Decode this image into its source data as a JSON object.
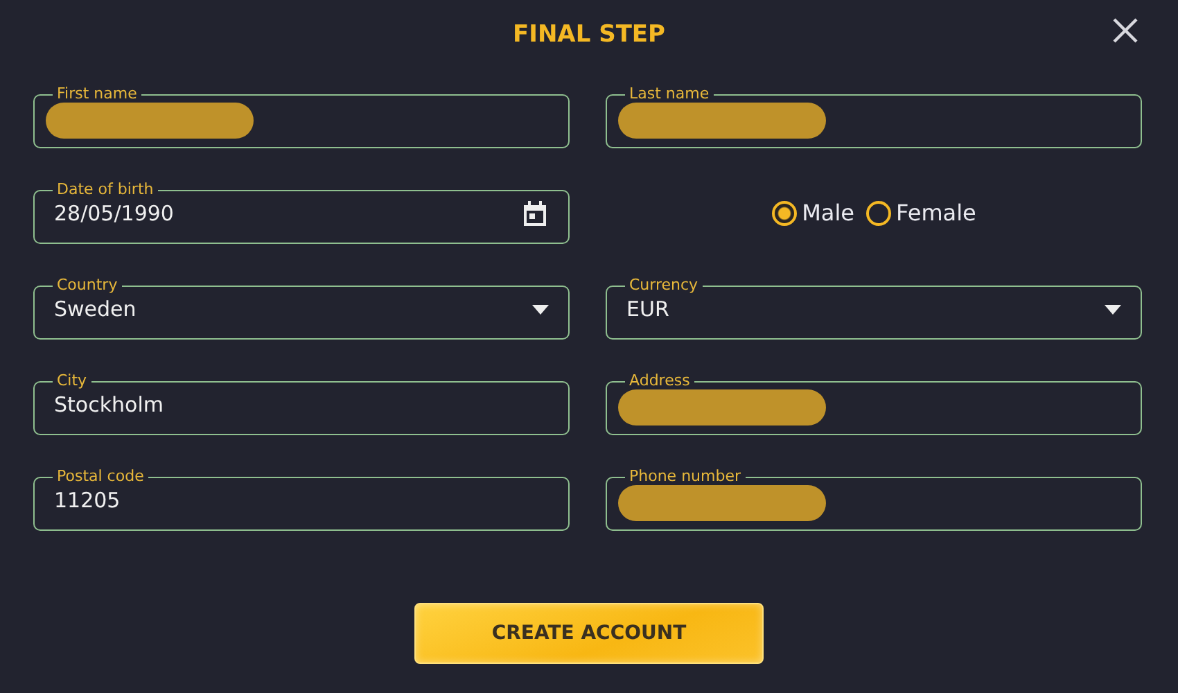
{
  "title": "FINAL STEP",
  "rows": [
    {
      "left": {
        "kind": "text",
        "label": "First name",
        "redacted": true
      },
      "right": {
        "kind": "text",
        "label": "Last name",
        "redacted": true
      }
    },
    {
      "left": {
        "kind": "date",
        "label": "Date of birth",
        "value": "28/05/1990",
        "redacted": false
      },
      "right": {
        "kind": "radio",
        "options": [
          {
            "label": "Male",
            "selected": true
          },
          {
            "label": "Female",
            "selected": false
          }
        ]
      }
    },
    {
      "left": {
        "kind": "select",
        "label": "Country",
        "value": "Sweden",
        "redacted": false
      },
      "right": {
        "kind": "select",
        "label": "Currency",
        "value": "EUR",
        "redacted": false
      }
    },
    {
      "left": {
        "kind": "text",
        "label": "City",
        "value": "Stockholm",
        "redacted": false
      },
      "right": {
        "kind": "text",
        "label": "Address",
        "redacted": true
      }
    },
    {
      "left": {
        "kind": "text",
        "label": "Postal code",
        "value": "11205",
        "redacted": false
      },
      "right": {
        "kind": "text",
        "label": "Phone number",
        "redacted": true
      }
    }
  ],
  "submit": "CREATE ACCOUNT"
}
